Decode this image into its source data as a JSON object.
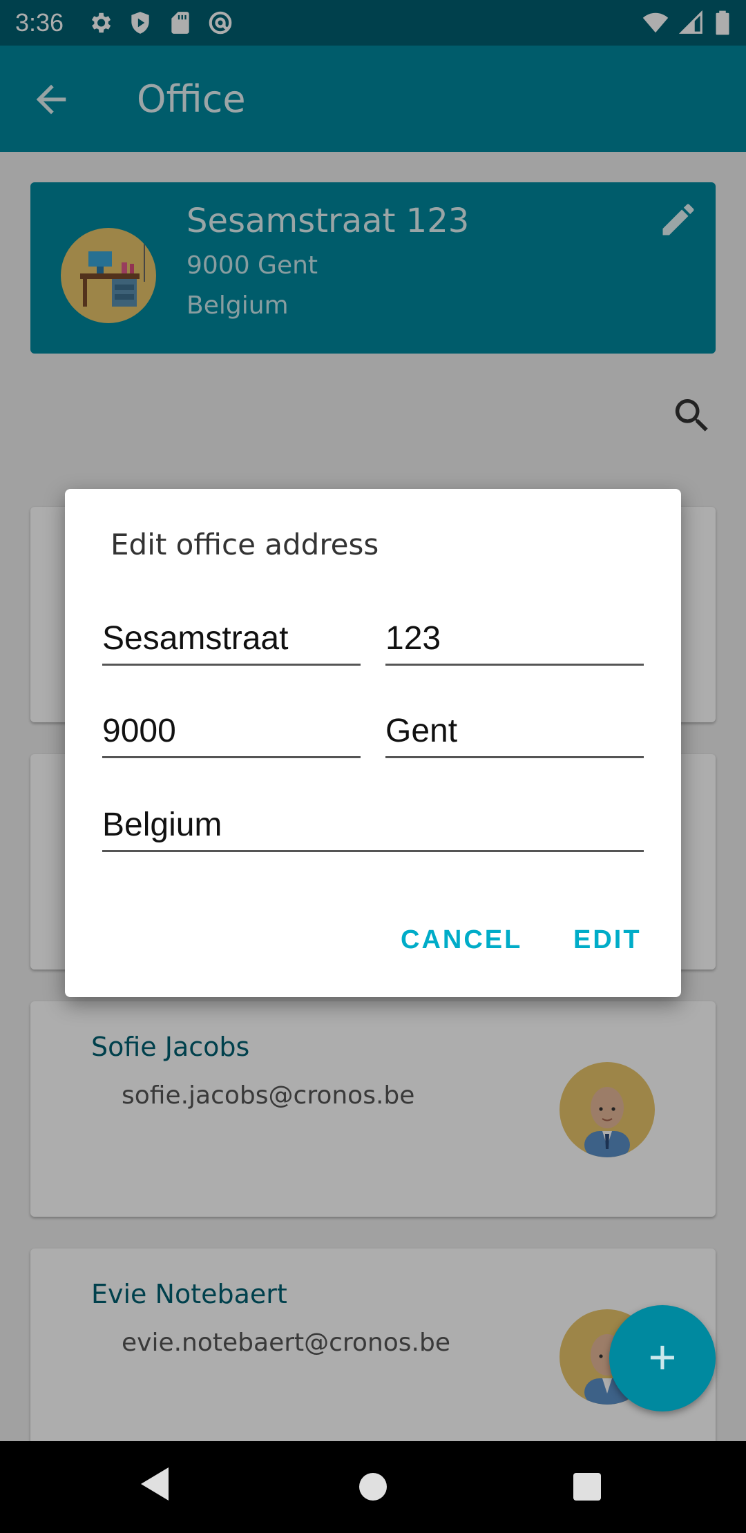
{
  "status_bar": {
    "time": "3:36",
    "left_icons": [
      "settings-icon",
      "shield-play-icon",
      "sd-card-icon",
      "at-sign-icon"
    ],
    "right_icons": [
      "wifi-icon",
      "signal-icon",
      "battery-icon"
    ]
  },
  "app_bar": {
    "title": "Office",
    "back_icon": "arrow-left-icon",
    "color": "#00889e"
  },
  "office_card": {
    "street": "Sesamstraat 123",
    "city": "9000 Gent",
    "country": "Belgium",
    "edit_icon": "pencil-icon"
  },
  "employees": [
    {
      "name": "Sofie Jacobs",
      "email": "sofie.jacobs@cronos.be"
    },
    {
      "name": "Evie Notebaert",
      "email": "evie.notebaert@cronos.be"
    }
  ],
  "fab": {
    "icon": "plus-icon",
    "label": "+"
  },
  "dialog": {
    "title": "Edit office address",
    "street": "Sesamstraat",
    "number": "123",
    "postal_code": "9000",
    "city": "Gent",
    "country": "Belgium",
    "cancel_label": "CANCEL",
    "confirm_label": "EDIT",
    "accent_color": "#00acc8"
  },
  "nav_bar": {
    "icons": [
      "nav-back-icon",
      "nav-home-icon",
      "nav-recents-icon"
    ]
  }
}
